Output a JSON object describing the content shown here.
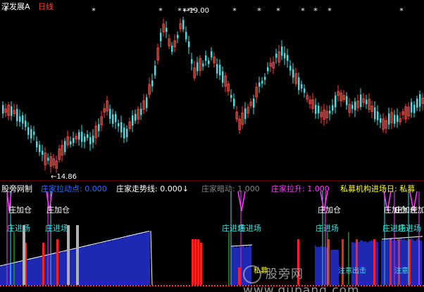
{
  "header": {
    "market": "深发展A",
    "period": "日线"
  },
  "price_chart": {
    "high_label": "←19.00",
    "low_label": "←14.86",
    "marker_glyph": "*",
    "colors": {
      "up": "#ff3b3b",
      "down": "#3fe0e0",
      "marker": "#ffffff"
    }
  },
  "indicator_bar": {
    "name": "股旁网制",
    "items": [
      {
        "label": "庄家拉动点:",
        "value": "0.000",
        "color": "#2a6bff"
      },
      {
        "label": "庄家走势线:",
        "value": "0.000↓",
        "color": "#ffffff"
      },
      {
        "label": "庄家暗动:",
        "value": "1.000",
        "color": "#808080"
      },
      {
        "label": "庄家拉升:",
        "value": "1.000",
        "color": "#ff3bff"
      },
      {
        "label": "私募机构进场日:",
        "value": "私募",
        "color": "#ffff00"
      }
    ]
  },
  "signals": {
    "add_label": "庄加仓",
    "enter_label": "庄进场",
    "private_label": "私募",
    "pay_label": "注意出击",
    "extra_label": "注意"
  },
  "watermark": {
    "text": "股旁网  www.gupang.com"
  }
}
